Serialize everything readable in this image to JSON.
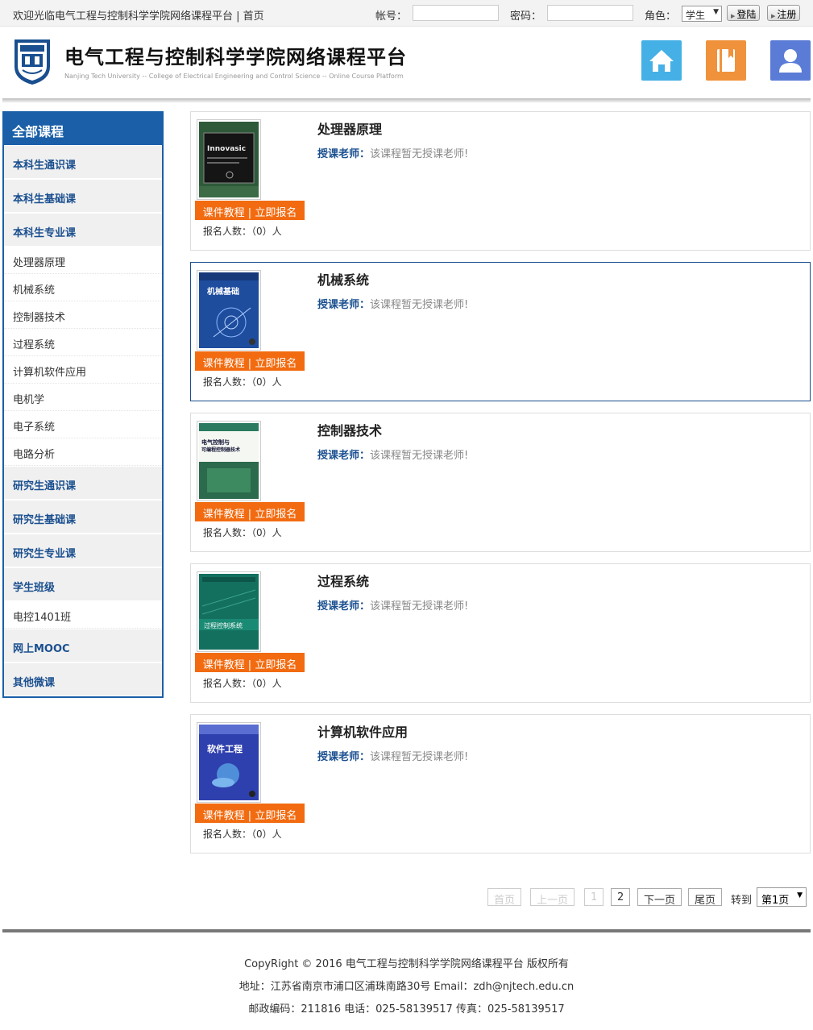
{
  "topbar": {
    "welcome": "欢迎光临电气工程与控制科学学院网络课程平台 | 首页",
    "account_label": "帐号：",
    "password_label": "密码：",
    "role_label": "角色：",
    "role_value": "学生",
    "login_btn": "登陆",
    "register_btn": "注册"
  },
  "header": {
    "title": "电气工程与控制科学学院网络课程平台",
    "subtitle": "Nanjing Tech University -- College of Electrical Engineering and Control Science -- Online Course Platform",
    "icons": [
      {
        "name": "home-icon",
        "color": "#45b0e6"
      },
      {
        "name": "book-icon",
        "color": "#f0923c"
      },
      {
        "name": "user-icon",
        "color": "#5b7cd6"
      }
    ]
  },
  "sidebar": {
    "head": "全部课程",
    "items": [
      {
        "type": "cat",
        "label": "本科生通识课"
      },
      {
        "type": "cat",
        "label": "本科生基础课"
      },
      {
        "type": "cat",
        "label": "本科生专业课"
      },
      {
        "type": "sub",
        "label": "处理器原理"
      },
      {
        "type": "sub",
        "label": "机械系统"
      },
      {
        "type": "sub",
        "label": "控制器技术"
      },
      {
        "type": "sub",
        "label": "过程系统"
      },
      {
        "type": "sub",
        "label": "计算机软件应用"
      },
      {
        "type": "sub",
        "label": "电机学"
      },
      {
        "type": "sub",
        "label": "电子系统"
      },
      {
        "type": "sub",
        "label": "电路分析"
      },
      {
        "type": "cat",
        "label": "研究生通识课"
      },
      {
        "type": "cat",
        "label": "研究生基础课"
      },
      {
        "type": "cat",
        "label": "研究生专业课"
      },
      {
        "type": "cat",
        "label": "学生班级"
      },
      {
        "type": "sub",
        "label": "电控1401班"
      },
      {
        "type": "cat",
        "label": "网上MOOC"
      },
      {
        "type": "cat",
        "label": "其他微课"
      }
    ]
  },
  "courses": [
    {
      "name": "处理器原理",
      "teacher_label": "授课老师：",
      "teacher": "该课程暂无授课老师!",
      "courseware": "课件教程",
      "sep": "|",
      "enroll": "立即报名",
      "count": "报名人数：（0）人",
      "cover": "chip",
      "cover_text": "Innovasic"
    },
    {
      "name": "机械系统",
      "teacher_label": "授课老师：",
      "teacher": "该课程暂无授课老师!",
      "courseware": "课件教程",
      "sep": "|",
      "enroll": "立即报名",
      "count": "报名人数：（0）人",
      "cover": "mech",
      "cover_text": "机械基础"
    },
    {
      "name": "控制器技术",
      "teacher_label": "授课老师：",
      "teacher": "该课程暂无授课老师!",
      "courseware": "课件教程",
      "sep": "|",
      "enroll": "立即报名",
      "count": "报名人数：（0）人",
      "cover": "ctrl",
      "cover_text": "电气控制与可编程控制器技术"
    },
    {
      "name": "过程系统",
      "teacher_label": "授课老师：",
      "teacher": "该课程暂无授课老师!",
      "courseware": "课件教程",
      "sep": "|",
      "enroll": "立即报名",
      "count": "报名人数：（0）人",
      "cover": "proc",
      "cover_text": "过程控制系统"
    },
    {
      "name": "计算机软件应用",
      "teacher_label": "授课老师：",
      "teacher": "该课程暂无授课老师!",
      "courseware": "课件教程",
      "sep": "|",
      "enroll": "立即报名",
      "count": "报名人数：（0）人",
      "cover": "soft",
      "cover_text": "软件工程"
    }
  ],
  "pager": {
    "first": "首页",
    "prev": "上一页",
    "p1": "1",
    "p2": "2",
    "next": "下一页",
    "last": "尾页",
    "goto": "转到",
    "select": "第1页"
  },
  "footer": {
    "copyright": "CopyRight © 2016 电气工程与控制科学学院网络课程平台 版权所有",
    "address": "地址：江苏省南京市浦口区浦珠南路30号   Email：zdh@njtech.edu.cn",
    "postal": "邮政编码：211816   电话：025-58139517   传真：025-58139517"
  }
}
